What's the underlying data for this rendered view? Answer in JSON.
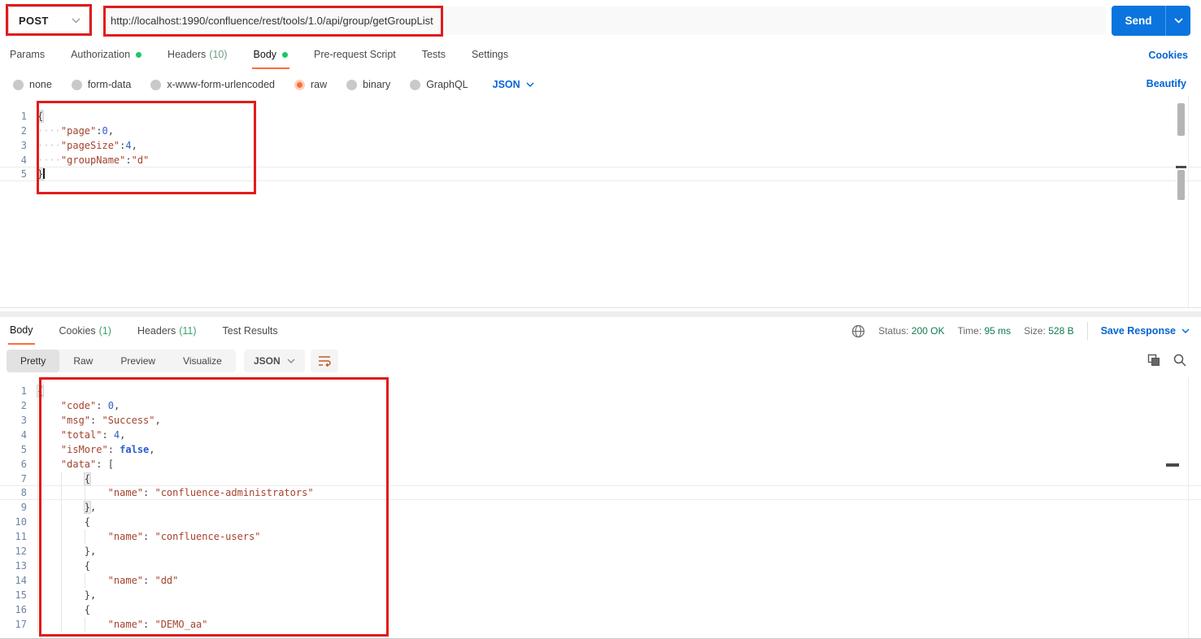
{
  "request_bar": {
    "method": "POST",
    "url": "http://localhost:1990/confluence/rest/tools/1.0/api/group/getGroupList",
    "send_label": "Send"
  },
  "request_tabs": {
    "items": [
      {
        "label": "Params"
      },
      {
        "label": "Authorization",
        "dot": true
      },
      {
        "label": "Headers",
        "count": "(10)"
      },
      {
        "label": "Body",
        "dot": true,
        "active": true
      },
      {
        "label": "Pre-request Script"
      },
      {
        "label": "Tests"
      },
      {
        "label": "Settings"
      }
    ],
    "cookies_link": "Cookies"
  },
  "body_type": {
    "options": [
      {
        "label": "none"
      },
      {
        "label": "form-data"
      },
      {
        "label": "x-www-form-urlencoded"
      },
      {
        "label": "raw",
        "selected": true
      },
      {
        "label": "binary"
      },
      {
        "label": "GraphQL"
      }
    ],
    "language": "JSON",
    "beautify_link": "Beautify"
  },
  "request_editor": {
    "lines": [
      {
        "no": "1",
        "t": [
          [
            "pb",
            "{"
          ]
        ]
      },
      {
        "no": "2",
        "t": [
          [
            "dots",
            "····"
          ],
          [
            "k",
            "\"page\""
          ],
          [
            "p",
            ":"
          ],
          [
            "n",
            "0"
          ],
          [
            "p",
            ","
          ]
        ]
      },
      {
        "no": "3",
        "t": [
          [
            "dots",
            "····"
          ],
          [
            "k",
            "\"pageSize\""
          ],
          [
            "p",
            ":"
          ],
          [
            "n",
            "4"
          ],
          [
            "p",
            ","
          ]
        ]
      },
      {
        "no": "4",
        "t": [
          [
            "dots",
            "····"
          ],
          [
            "k",
            "\"groupName\""
          ],
          [
            "p",
            ":"
          ],
          [
            "s",
            "\"d\""
          ]
        ]
      },
      {
        "no": "5",
        "hl": true,
        "t": [
          [
            "pb",
            "}"
          ],
          [
            "cur",
            ""
          ]
        ]
      }
    ]
  },
  "response_meta": {
    "tabs": [
      {
        "label": "Body",
        "active": true
      },
      {
        "label": "Cookies",
        "count": "(1)"
      },
      {
        "label": "Headers",
        "count": "(11)"
      },
      {
        "label": "Test Results"
      }
    ],
    "status_label": "Status:",
    "status_value": "200 OK",
    "time_label": "Time:",
    "time_value": "95 ms",
    "size_label": "Size:",
    "size_value": "528 B",
    "save_label": "Save Response"
  },
  "response_toolbar": {
    "views": [
      {
        "label": "Pretty",
        "active": true
      },
      {
        "label": "Raw"
      },
      {
        "label": "Preview"
      },
      {
        "label": "Visualize"
      }
    ],
    "language": "JSON"
  },
  "response_editor": {
    "lines": [
      {
        "no": "1",
        "t": [
          [
            "pb",
            "{"
          ]
        ]
      },
      {
        "no": "2",
        "t": [
          [
            "ind",
            "    "
          ],
          [
            "k",
            "\"code\""
          ],
          [
            "p",
            ": "
          ],
          [
            "n",
            "0"
          ],
          [
            "p",
            ","
          ]
        ]
      },
      {
        "no": "3",
        "t": [
          [
            "ind",
            "    "
          ],
          [
            "k",
            "\"msg\""
          ],
          [
            "p",
            ": "
          ],
          [
            "s",
            "\"Success\""
          ],
          [
            "p",
            ","
          ]
        ]
      },
      {
        "no": "4",
        "t": [
          [
            "ind",
            "    "
          ],
          [
            "k",
            "\"total\""
          ],
          [
            "p",
            ": "
          ],
          [
            "n",
            "4"
          ],
          [
            "p",
            ","
          ]
        ]
      },
      {
        "no": "5",
        "t": [
          [
            "ind",
            "    "
          ],
          [
            "k",
            "\"isMore\""
          ],
          [
            "p",
            ": "
          ],
          [
            "b",
            "false"
          ],
          [
            "p",
            ","
          ]
        ]
      },
      {
        "no": "6",
        "t": [
          [
            "ind",
            "    "
          ],
          [
            "k",
            "\"data\""
          ],
          [
            "p",
            ": "
          ],
          [
            "p",
            "["
          ]
        ]
      },
      {
        "no": "7",
        "t": [
          [
            "ind",
            "    "
          ],
          [
            "ind",
            "    "
          ],
          [
            "pb",
            "{"
          ]
        ]
      },
      {
        "no": "8",
        "hl": true,
        "t": [
          [
            "ind",
            "    "
          ],
          [
            "ind",
            "    "
          ],
          [
            "ind",
            "    "
          ],
          [
            "k",
            "\"name\""
          ],
          [
            "p",
            ": "
          ],
          [
            "s",
            "\"confluence-administrators\""
          ]
        ]
      },
      {
        "no": "9",
        "t": [
          [
            "ind",
            "    "
          ],
          [
            "ind",
            "    "
          ],
          [
            "pb",
            "}"
          ],
          [
            "p",
            ","
          ]
        ]
      },
      {
        "no": "10",
        "t": [
          [
            "ind",
            "    "
          ],
          [
            "ind",
            "    "
          ],
          [
            "p",
            "{"
          ]
        ]
      },
      {
        "no": "11",
        "t": [
          [
            "ind",
            "    "
          ],
          [
            "ind",
            "    "
          ],
          [
            "ind",
            "    "
          ],
          [
            "k",
            "\"name\""
          ],
          [
            "p",
            ": "
          ],
          [
            "s",
            "\"confluence-users\""
          ]
        ]
      },
      {
        "no": "12",
        "t": [
          [
            "ind",
            "    "
          ],
          [
            "ind",
            "    "
          ],
          [
            "p",
            "}"
          ],
          [
            "p",
            ","
          ]
        ]
      },
      {
        "no": "13",
        "t": [
          [
            "ind",
            "    "
          ],
          [
            "ind",
            "    "
          ],
          [
            "p",
            "{"
          ]
        ]
      },
      {
        "no": "14",
        "t": [
          [
            "ind",
            "    "
          ],
          [
            "ind",
            "    "
          ],
          [
            "ind",
            "    "
          ],
          [
            "k",
            "\"name\""
          ],
          [
            "p",
            ": "
          ],
          [
            "s",
            "\"dd\""
          ]
        ]
      },
      {
        "no": "15",
        "t": [
          [
            "ind",
            "    "
          ],
          [
            "ind",
            "    "
          ],
          [
            "p",
            "}"
          ],
          [
            "p",
            ","
          ]
        ]
      },
      {
        "no": "16",
        "t": [
          [
            "ind",
            "    "
          ],
          [
            "ind",
            "    "
          ],
          [
            "p",
            "{"
          ]
        ]
      },
      {
        "no": "17",
        "t": [
          [
            "ind",
            "    "
          ],
          [
            "ind",
            "    "
          ],
          [
            "ind",
            "    "
          ],
          [
            "k",
            "\"name\""
          ],
          [
            "p",
            ": "
          ],
          [
            "s",
            "\"DEMO_aa\""
          ]
        ]
      }
    ]
  },
  "icons": {
    "method_caret": "chevron-down-icon",
    "send_caret": "chevron-down-icon",
    "globe": "globe-icon",
    "wrap": "wrap-text-icon",
    "copy": "copy-icon",
    "search": "search-icon"
  },
  "colors": {
    "accent_orange": "#ff6c37",
    "send_blue": "#0b74de",
    "link_blue": "#0265d2",
    "status_green": "#0f7b4f",
    "annotation_red": "#e21b1b",
    "json_key": "#a5422c",
    "json_number": "#2b5dcd"
  }
}
